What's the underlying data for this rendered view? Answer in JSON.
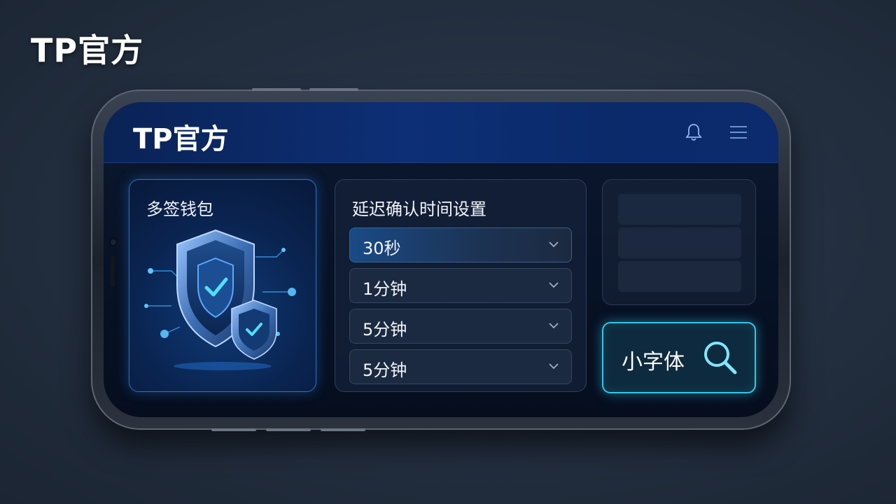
{
  "brand": {
    "title": "TP官方"
  },
  "app": {
    "title": "TP官方",
    "icons": {
      "notification": "bell-icon",
      "menu": "hamburger-menu-icon"
    }
  },
  "cards": {
    "multisig": {
      "title": "多签钱包",
      "illustration": "shield-check-icon"
    },
    "delay": {
      "title": "延迟确认时间设置",
      "options": [
        {
          "value": "30秒",
          "active": true
        },
        {
          "value": "1分钟",
          "active": false
        },
        {
          "value": "5分钟",
          "active": false
        },
        {
          "value": "5分钟",
          "active": false
        }
      ]
    },
    "small_font_button": {
      "label": "小字体",
      "icon": "search-icon"
    }
  },
  "colors": {
    "accent_cyan": "#34c6e6",
    "accent_blue": "#2e73c9",
    "header_blue": "#0d2f76"
  }
}
